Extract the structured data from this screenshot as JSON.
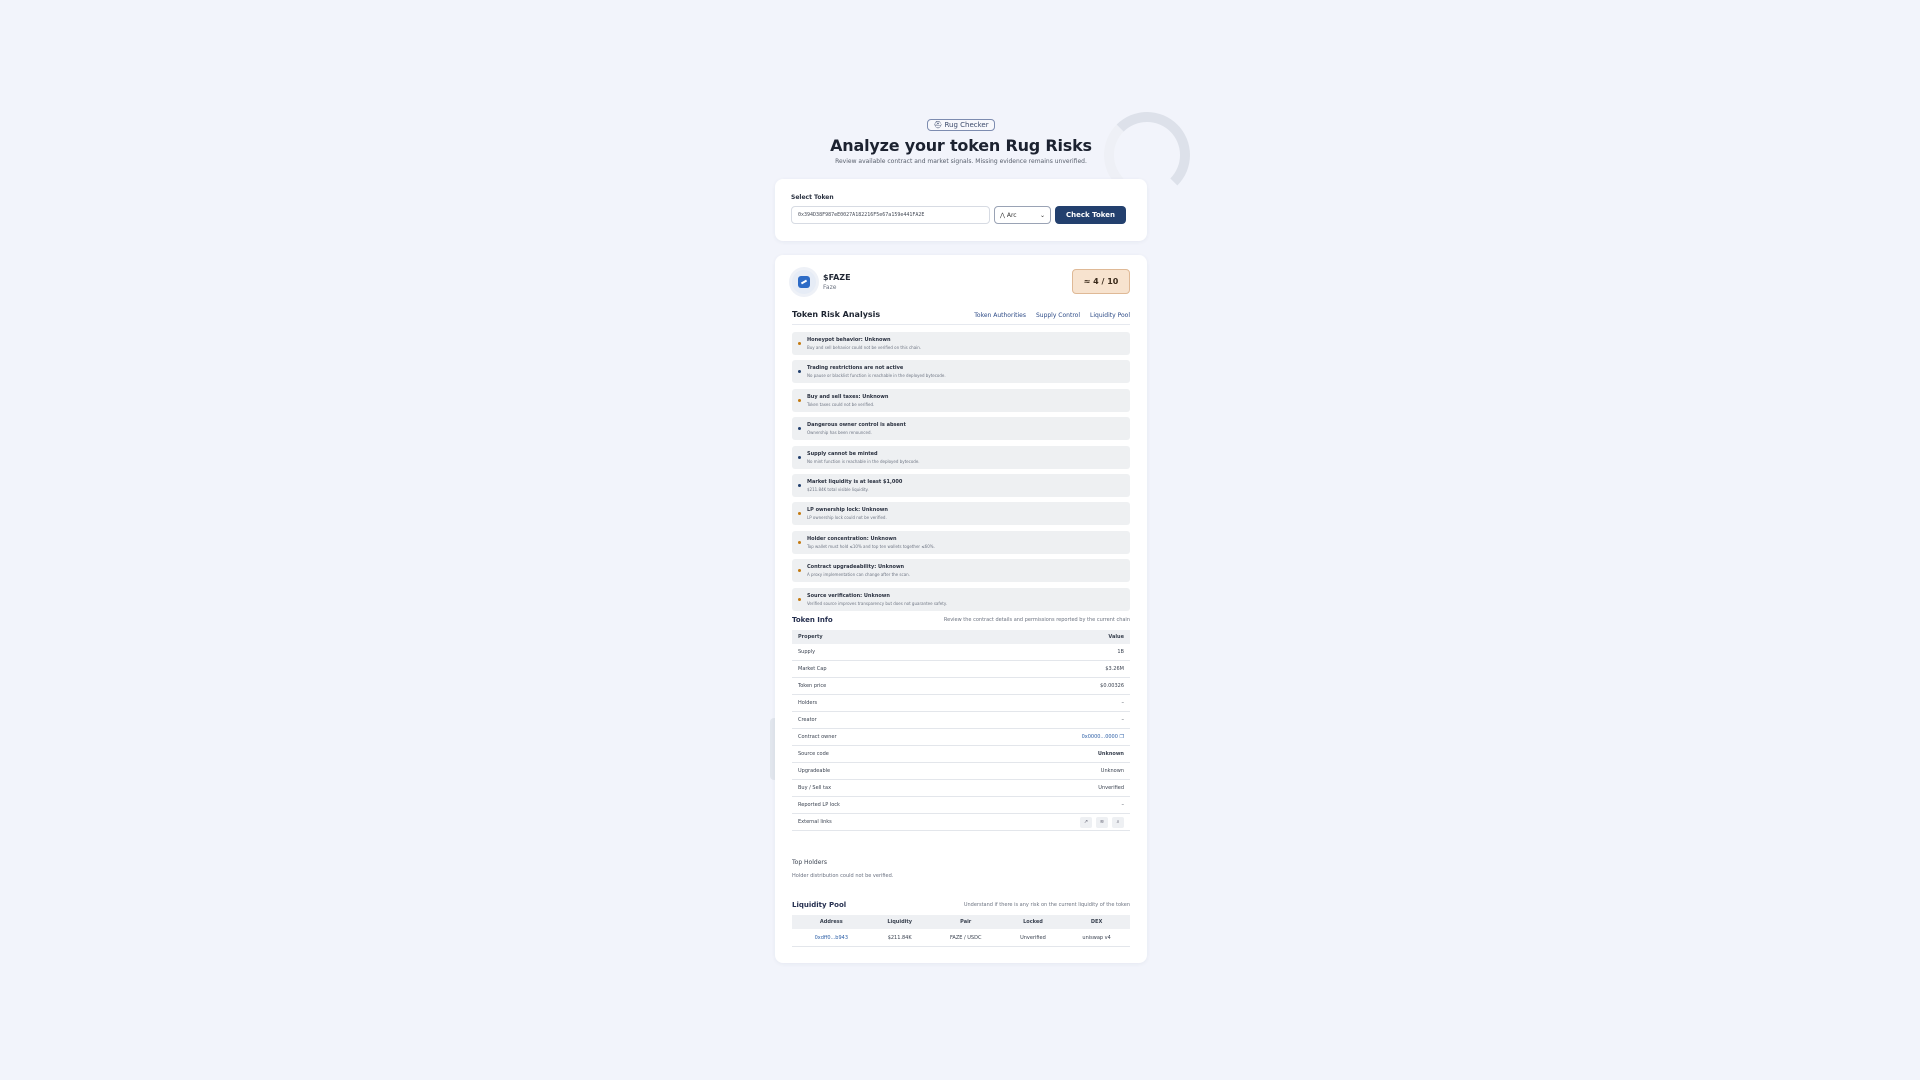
{
  "hero": {
    "badge": "⛑ Rug Checker",
    "title": "Analyze your token Rug Risks",
    "subtitle": "Review available contract and market signals. Missing evidence remains unverified."
  },
  "select": {
    "label": "Select Token",
    "address": "0x394D38F987eE0027A182216F5e67a159e441FA2E",
    "chain": "Arc",
    "check_label": "Check Token"
  },
  "token": {
    "symbol": "$FAZE",
    "name": "Faze",
    "score": "≈ 4 / 10",
    "score_color": "#f7e3cf"
  },
  "analysis": {
    "title": "Token Risk Analysis",
    "tabs": [
      "Token Authorities",
      "Supply Control",
      "Liquidity Pool"
    ],
    "risks": [
      {
        "title": "Honeypot behavior: Unknown",
        "desc": "Buy and sell behavior could not be verified on this chain.",
        "status": "warn"
      },
      {
        "title": "Trading restrictions are not active",
        "desc": "No pause or blacklist function is reachable in the deployed bytecode.",
        "status": "ok"
      },
      {
        "title": "Buy and sell taxes: Unknown",
        "desc": "Token taxes could not be verified.",
        "status": "warn"
      },
      {
        "title": "Dangerous owner control is absent",
        "desc": "Ownership has been renounced.",
        "status": "ok"
      },
      {
        "title": "Supply cannot be minted",
        "desc": "No mint function is reachable in the deployed bytecode.",
        "status": "ok"
      },
      {
        "title": "Market liquidity is at least $1,000",
        "desc": "$211.84K total visible liquidity.",
        "status": "ok"
      },
      {
        "title": "LP ownership lock: Unknown",
        "desc": "LP ownership lock could not be verified.",
        "status": "warn"
      },
      {
        "title": "Holder concentration: Unknown",
        "desc": "Top wallet must hold ≤10% and top ten wallets together ≤60%.",
        "status": "warn"
      },
      {
        "title": "Contract upgradeability: Unknown",
        "desc": "A proxy implementation can change after the scan.",
        "status": "warn"
      },
      {
        "title": "Source verification: Unknown",
        "desc": "Verified source improves transparency but does not guarantee safety.",
        "status": "warn"
      }
    ],
    "ok_color": "#23406e",
    "warn_color": "#c47a12"
  },
  "token_info": {
    "title": "Token Info",
    "note": "Review the contract details and permissions reported by the current chain",
    "header": {
      "property": "Property",
      "value": "Value"
    },
    "rows": [
      {
        "k": "Supply",
        "v": "1B"
      },
      {
        "k": "Market Cap",
        "v": "$3.26M"
      },
      {
        "k": "Token price",
        "v": "$0.00326"
      },
      {
        "k": "Holders",
        "v": "–"
      },
      {
        "k": "Creator",
        "v": "–"
      },
      {
        "k": "Contract owner",
        "v": "0x0000...0000"
      },
      {
        "k": "Source code",
        "v": "Unknown"
      },
      {
        "k": "Upgradeable",
        "v": "Unknown"
      },
      {
        "k": "Buy / Sell tax",
        "v": "Unverified"
      },
      {
        "k": "Reported LP lock",
        "v": "–"
      }
    ],
    "external_label": "External links",
    "external_icons": [
      "external-link-icon",
      "explorer-icon",
      "search-icon"
    ]
  },
  "holders": {
    "title": "Top Holders",
    "desc": "Holder distribution could not be verified."
  },
  "liquidity": {
    "title": "Liquidity Pool",
    "note": "Understand if there is any risk on the current liquidity of the token",
    "headers": [
      "Address",
      "Liquidity",
      "Pair",
      "Locked",
      "DEX"
    ],
    "rows": [
      [
        "0xdff0...b943",
        "$211.84K",
        "FAZE / USDC",
        "Unverified",
        "uniswap v4"
      ]
    ]
  }
}
